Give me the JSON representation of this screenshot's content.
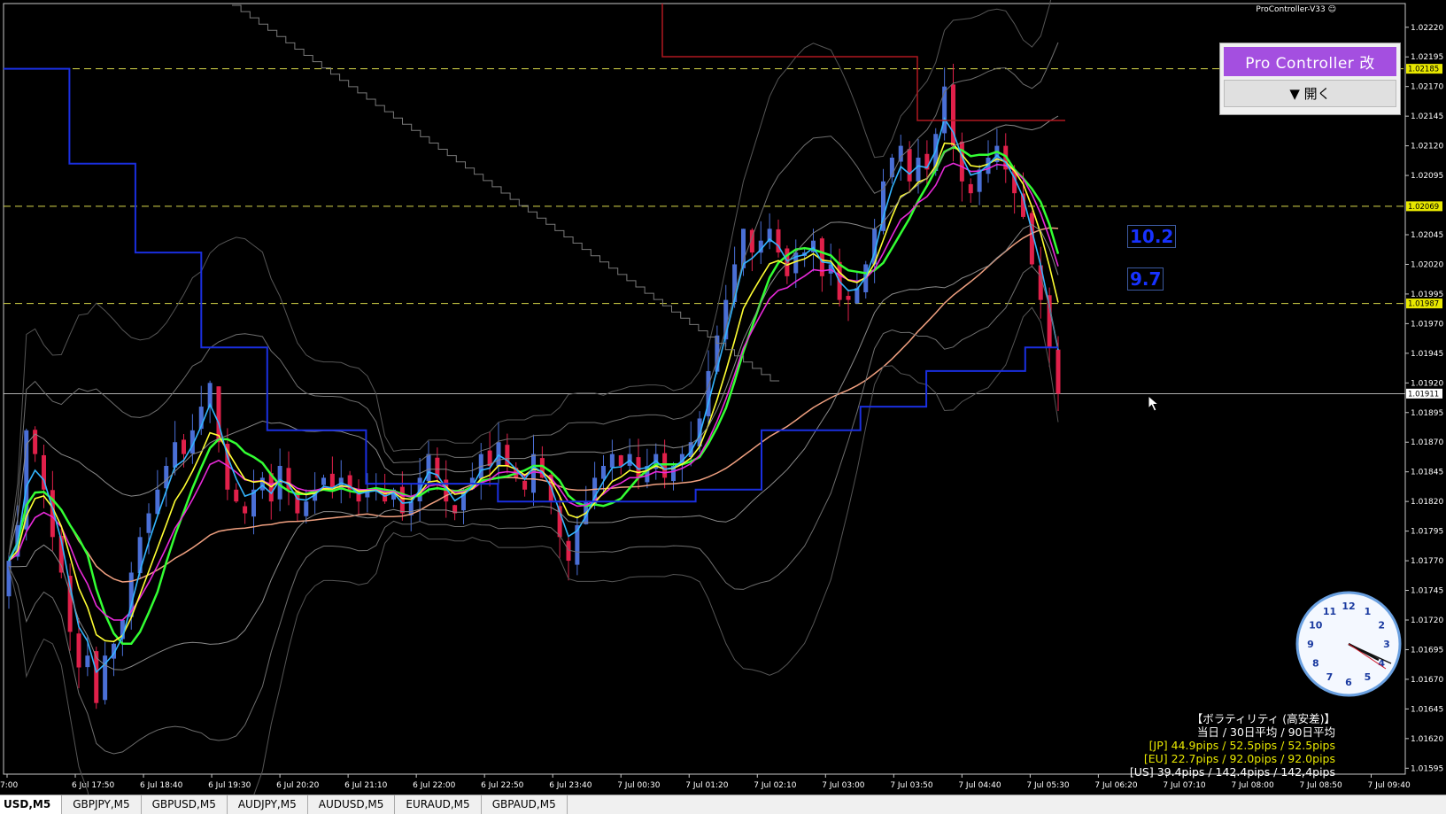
{
  "indicator_name": "ProController-V33",
  "pro_controller": {
    "title": "Pro Controller 改",
    "open_label": "▼ 開く"
  },
  "num_boxes": [
    "10.2",
    "9.7"
  ],
  "volatility": {
    "title": "【ボラティリティ (高安差)】",
    "header": "当日 / 30日平均 / 90日平均",
    "jp": "[JP] 44.9pips / 52.5pips / 52.5pips",
    "eu": "[EU] 22.7pips / 92.0pips / 92.0pips",
    "us": "[US] 39.4pips / 142.4pips / 142.4pips"
  },
  "tabs": [
    {
      "label": "USD,M5",
      "active": true
    },
    {
      "label": "GBPJPY,M5",
      "active": false
    },
    {
      "label": "GBPUSD,M5",
      "active": false
    },
    {
      "label": "AUDJPY,M5",
      "active": false
    },
    {
      "label": "AUDUSD,M5",
      "active": false
    },
    {
      "label": "EURAUD,M5",
      "active": false
    },
    {
      "label": "GBPAUD,M5",
      "active": false
    }
  ],
  "colors": {
    "background": "#000000",
    "bull": "#4a6fd6",
    "bear": "#e0204a",
    "ma_yellow": "#ffff33",
    "ma_cyan": "#33b5ff",
    "ma_magenta": "#e82ad8",
    "ma_green": "#33ff33",
    "ma_salmon": "#f0a080",
    "trend_blue": "#1a2fe0",
    "dashed_yellow": "#d8d84a",
    "current_price": "#e8e8e8"
  },
  "chart_data": {
    "type": "candlestick",
    "symbol_timeframe": "M5",
    "y_ticks": [
      "1.02220",
      "1.02195",
      "1.02170",
      "1.02145",
      "1.02120",
      "1.02095",
      "1.02045",
      "1.02020",
      "1.01995",
      "1.01970",
      "1.01945",
      "1.01920",
      "1.01895",
      "1.01870",
      "1.01845",
      "1.01820",
      "1.01795",
      "1.01770",
      "1.01745",
      "1.01720",
      "1.01695",
      "1.01670",
      "1.01645",
      "1.01620",
      "1.01595"
    ],
    "ylim": [
      1.0159,
      1.0224
    ],
    "x_ticks": [
      "7:00",
      "6 Jul 17:50",
      "6 Jul 18:40",
      "6 Jul 19:30",
      "6 Jul 20:20",
      "6 Jul 21:10",
      "6 Jul 22:00",
      "6 Jul 22:50",
      "6 Jul 23:40",
      "7 Jul 00:30",
      "7 Jul 01:20",
      "7 Jul 02:10",
      "7 Jul 03:00",
      "7 Jul 03:50",
      "7 Jul 04:40",
      "7 Jul 05:30",
      "7 Jul 06:20",
      "7 Jul 07:10",
      "7 Jul 08:00",
      "7 Jul 08:50",
      "7 Jul 09:40"
    ],
    "price_labels": [
      {
        "value": "1.02185",
        "highlight": true
      },
      {
        "value": "1.02069",
        "highlight": true
      },
      {
        "value": "1.01987",
        "highlight": true
      },
      {
        "value": "1.01911",
        "highlight": false
      }
    ],
    "dashed_levels": [
      1.02185,
      1.02069,
      1.01987
    ],
    "current_price": 1.01911,
    "closes": [
      1.0177,
      1.018,
      1.0188,
      1.0186,
      1.0183,
      1.0179,
      1.0176,
      1.0171,
      1.0168,
      1.0169,
      1.0165,
      1.0169,
      1.017,
      1.0172,
      1.0176,
      1.0179,
      1.0181,
      1.0183,
      1.0185,
      1.0187,
      1.0186,
      1.0188,
      1.019,
      1.0192,
      1.0187,
      1.0183,
      1.0182,
      1.0181,
      1.0183,
      1.0184,
      1.0182,
      1.0185,
      1.0183,
      1.0181,
      1.0182,
      1.0183,
      1.0184,
      1.0183,
      1.0184,
      1.0183,
      1.0182,
      1.0183,
      1.0183,
      1.0182,
      1.0183,
      1.0181,
      1.0182,
      1.0184,
      1.0186,
      1.0184,
      1.0182,
      1.0181,
      1.0183,
      1.0184,
      1.0186,
      1.0185,
      1.0187,
      1.0185,
      1.0184,
      1.0183,
      1.0186,
      1.0184,
      1.0182,
      1.0179,
      1.0177,
      1.018,
      1.0182,
      1.0184,
      1.0185,
      1.0186,
      1.0185,
      1.0186,
      1.0184,
      1.0185,
      1.0186,
      1.0184,
      1.0185,
      1.0186,
      1.0187,
      1.0189,
      1.0193,
      1.0196,
      1.0199,
      1.0202,
      1.0205,
      1.0203,
      1.0204,
      1.0205,
      1.0203,
      1.0201,
      1.0203,
      1.0203,
      1.0204,
      1.0201,
      1.0202,
      1.0199,
      1.0199,
      1.02,
      1.0202,
      1.0205,
      1.0209,
      1.0211,
      1.0212,
      1.0209,
      1.0211,
      1.021,
      1.0213,
      1.0217,
      1.0212,
      1.0209,
      1.0208,
      1.021,
      1.0211,
      1.0212,
      1.021,
      1.0208,
      1.0206,
      1.0202,
      1.0199,
      1.0195,
      1.01911
    ]
  }
}
